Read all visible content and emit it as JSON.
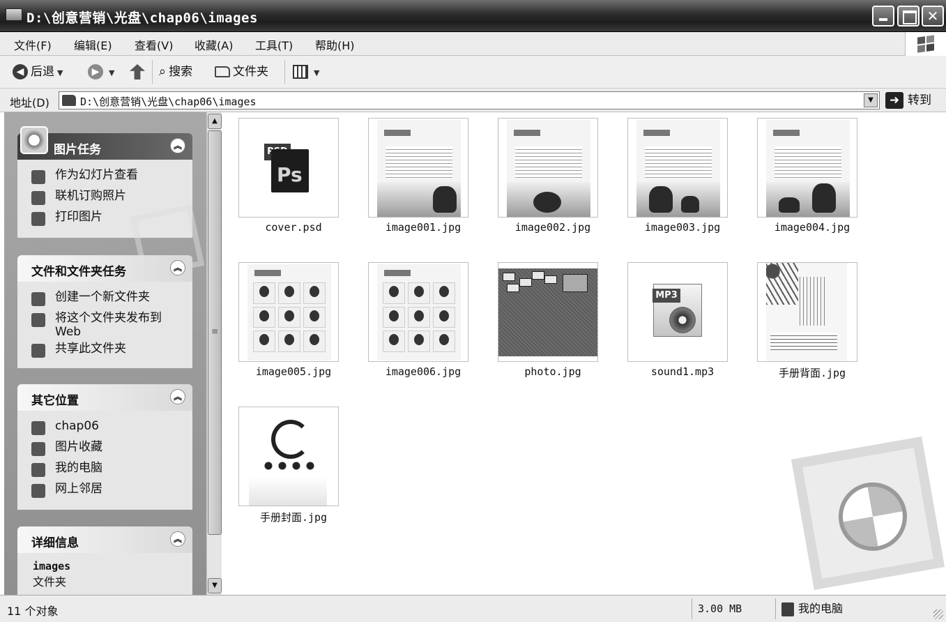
{
  "window": {
    "title": "D:\\创意营销\\光盘\\chap06\\images"
  },
  "menu": [
    "文件(F)",
    "编辑(E)",
    "查看(V)",
    "收藏(A)",
    "工具(T)",
    "帮助(H)"
  ],
  "toolbar": {
    "back": "后退",
    "search": "搜索",
    "folders": "文件夹"
  },
  "address": {
    "label": "地址(D)",
    "path": "D:\\创意营销\\光盘\\chap06\\images",
    "go": "转到"
  },
  "panels": {
    "picture_tasks": {
      "title": "图片任务",
      "items": [
        "作为幻灯片查看",
        "联机订购照片",
        "打印图片"
      ]
    },
    "file_tasks": {
      "title": "文件和文件夹任务",
      "items": [
        "创建一个新文件夹",
        "将这个文件夹发布到 Web",
        "共享此文件夹"
      ]
    },
    "other_places": {
      "title": "其它位置",
      "items": [
        "chap06",
        "图片收藏",
        "我的电脑",
        "网上邻居"
      ]
    },
    "details": {
      "title": "详细信息",
      "name": "images",
      "type": "文件夹"
    }
  },
  "files": [
    {
      "name": "cover.psd"
    },
    {
      "name": "image001.jpg"
    },
    {
      "name": "image002.jpg"
    },
    {
      "name": "image003.jpg"
    },
    {
      "name": "image004.jpg"
    },
    {
      "name": "image005.jpg"
    },
    {
      "name": "image006.jpg"
    },
    {
      "name": "photo.jpg"
    },
    {
      "name": "sound1.mp3"
    },
    {
      "name": "手册背面.jpg"
    },
    {
      "name": "手册封面.jpg"
    }
  ],
  "status": {
    "count": "11 个对象",
    "size": "3.00 MB",
    "location": "我的电脑"
  }
}
